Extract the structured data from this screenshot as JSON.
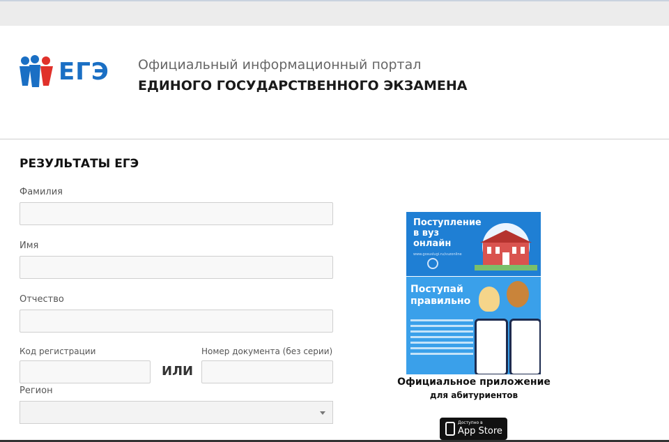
{
  "header": {
    "logo_text": "ЕГЭ",
    "portal_subtitle": "Официальный информационный портал",
    "portal_title": "ЕДИНОГО ГОСУДАРСТВЕННОГО ЭКЗАМЕНА"
  },
  "form": {
    "title": "РЕЗУЛЬТАТЫ ЕГЭ",
    "last_name_label": "Фамилия",
    "last_name_value": "",
    "first_name_label": "Имя",
    "first_name_value": "",
    "patronymic_label": "Отчество",
    "patronymic_value": "",
    "reg_code_label": "Код регистрации",
    "reg_code_value": "",
    "or_label": "ИЛИ",
    "doc_number_label": "Номер документа (без серии)",
    "doc_number_value": "",
    "region_label": "Регион",
    "region_value": ""
  },
  "promo": {
    "banner1_title": "Поступление в вуз онлайн",
    "banner1_url": "www.gosuslugi.ru/vuzonline",
    "banner2_title": "Поступай правильно",
    "caption_line1": "Официальное приложение",
    "caption_line2": "для абитуриентов",
    "appstore_small": "Доступно в",
    "appstore_big": "App Store"
  },
  "colors": {
    "logo_blue": "#1a6fc4",
    "logo_red": "#e0312b",
    "banner_blue": "#1f7fd4",
    "banner_light_blue": "#3aa0ea"
  }
}
